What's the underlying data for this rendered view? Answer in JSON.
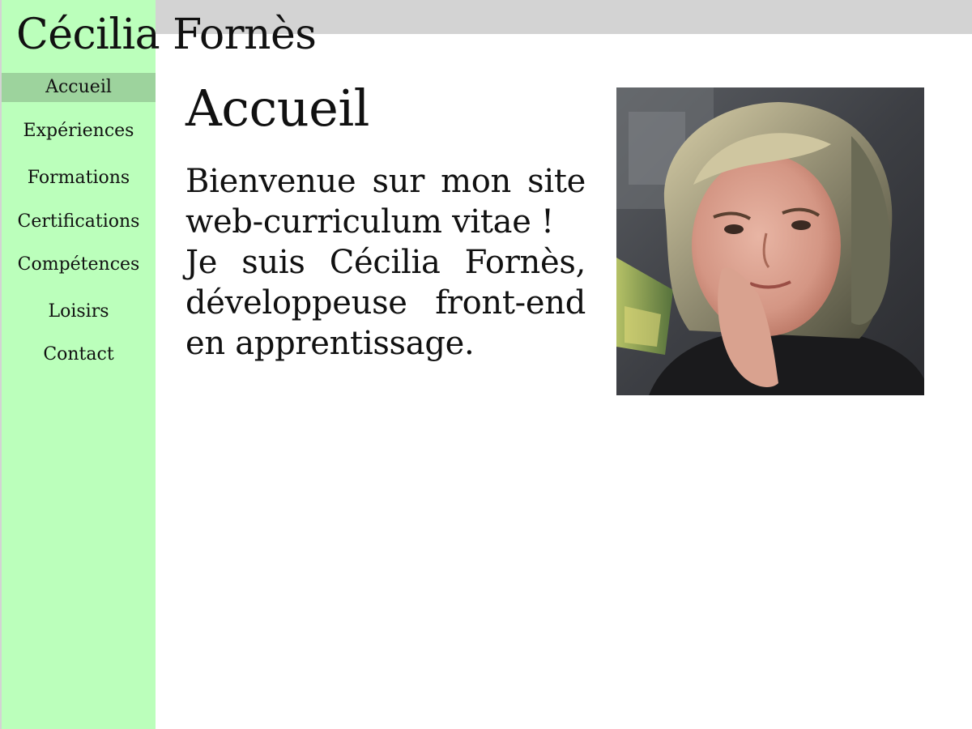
{
  "site": {
    "title": "Cécilia Fornès"
  },
  "nav": {
    "items": [
      {
        "label": "Accueil",
        "active": true
      },
      {
        "label": "Expériences",
        "active": false
      },
      {
        "label": "Formations",
        "active": false
      },
      {
        "label": "Certifications",
        "active": false
      },
      {
        "label": "Compétences",
        "active": false
      },
      {
        "label": "Loisirs",
        "active": false
      },
      {
        "label": "Contact",
        "active": false
      }
    ]
  },
  "main": {
    "title": "Accueil",
    "intro_line1": "Bienvenue sur mon site web-curriculum vitae !",
    "intro_line2": "Je suis Cécilia Fornès, développeuse front-end en apprentissage."
  },
  "colors": {
    "sidebar": "#bbffbb",
    "sidebar_active": "#9dd39d",
    "topbar": "#d3d3d3",
    "background": "#ffffff"
  }
}
